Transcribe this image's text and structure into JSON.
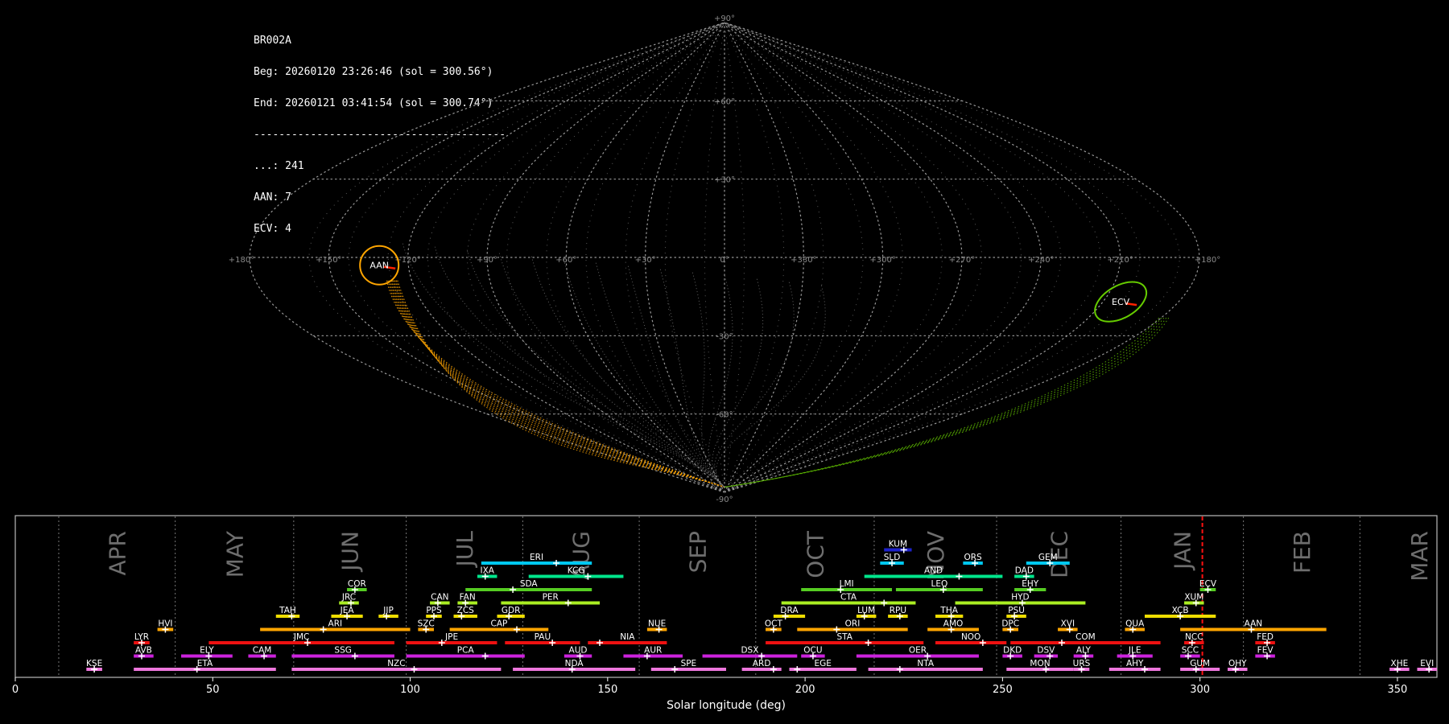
{
  "info": {
    "lines": [
      "BR002A",
      "Beg: 20260120 23:26:46 (sol = 300.56°)",
      "End: 20260121 03:41:54 (sol = 300.74°)",
      "----------------------------------------",
      "...: 241",
      "AAN: 7",
      "ECV: 4"
    ]
  },
  "chart_data": [
    {
      "type": "scatter",
      "projection": "sinusoidal",
      "lon_labels": [
        "+180°",
        "+150°",
        "+120°",
        "+90°",
        "+60°",
        "+30°",
        "0°",
        "+330°",
        "+300°",
        "+270°",
        "+240°",
        "+210°",
        "+180°"
      ],
      "lat_labels": [
        "+90°",
        "+60°",
        "+30°",
        "-30°",
        "-60°",
        "-90°"
      ],
      "showers": [
        {
          "code": "AAN",
          "lon": 150,
          "lat": -7,
          "color": "#ffa500",
          "count": 7
        },
        {
          "code": "ECV",
          "lon": 196,
          "lat": -20,
          "color": "#66cc00",
          "count": 4
        }
      ],
      "sporadic_count": 241,
      "grid": true
    },
    {
      "type": "gantt",
      "xlabel": "Solar longitude (deg)",
      "xlim": [
        0,
        360
      ],
      "xticks": [
        0,
        50,
        100,
        150,
        200,
        250,
        300,
        350
      ],
      "current_sol": 300.6,
      "months": [
        {
          "label": "APR",
          "start": 11
        },
        {
          "label": "MAY",
          "start": 40.5
        },
        {
          "label": "JUN",
          "start": 70.5
        },
        {
          "label": "JUL",
          "start": 99
        },
        {
          "label": "AUG",
          "start": 128.5
        },
        {
          "label": "SEP",
          "start": 158
        },
        {
          "label": "OCT",
          "start": 187.5
        },
        {
          "label": "NOV",
          "start": 217.5
        },
        {
          "label": "DEC",
          "start": 248.5
        },
        {
          "label": "JAN",
          "start": 280
        },
        {
          "label": "FEB",
          "start": 311
        },
        {
          "label": "MAR",
          "start": 340.5
        }
      ],
      "bars": [
        {
          "code": "KUM",
          "s": 220,
          "e": 227,
          "p": 225,
          "row": 9,
          "color": "#1e22cc"
        },
        {
          "code": "ERI",
          "s": 118,
          "e": 146,
          "p": 137,
          "row": 8,
          "color": "#00c8f0"
        },
        {
          "code": "SLD",
          "s": 219,
          "e": 225,
          "p": 222,
          "row": 8,
          "color": "#00c8f0"
        },
        {
          "code": "ORS",
          "s": 240,
          "e": 245,
          "p": 243,
          "row": 8,
          "color": "#00c8f0"
        },
        {
          "code": "GEM",
          "s": 256,
          "e": 267,
          "p": 262,
          "row": 8,
          "color": "#00c8f0"
        },
        {
          "code": "IXA",
          "s": 117,
          "e": 122,
          "p": 119,
          "row": 7,
          "color": "#00e68c"
        },
        {
          "code": "KCG",
          "s": 130,
          "e": 154,
          "p": 145,
          "row": 7,
          "color": "#00e68c"
        },
        {
          "code": "AND",
          "s": 215,
          "e": 250,
          "p": 239,
          "row": 7,
          "color": "#00e68c"
        },
        {
          "code": "DAD",
          "s": 253,
          "e": 258,
          "p": 256,
          "row": 7,
          "color": "#00e68c"
        },
        {
          "code": "COR",
          "s": 84,
          "e": 89,
          "p": 86,
          "row": 6,
          "color": "#55cc22"
        },
        {
          "code": "SDA",
          "s": 114,
          "e": 146,
          "p": 126,
          "row": 6,
          "color": "#55cc22"
        },
        {
          "code": "LMI",
          "s": 199,
          "e": 222,
          "p": 209,
          "row": 6,
          "color": "#55cc22"
        },
        {
          "code": "LEQ",
          "s": 223,
          "e": 245,
          "p": 235,
          "row": 6,
          "color": "#55cc22"
        },
        {
          "code": "EHY",
          "s": 253,
          "e": 261,
          "p": 257,
          "row": 6,
          "color": "#55cc22"
        },
        {
          "code": "ECV",
          "s": 300,
          "e": 304,
          "p": 302,
          "row": 6,
          "color": "#55cc22"
        },
        {
          "code": "JRC",
          "s": 82,
          "e": 87,
          "p": 85,
          "row": 5,
          "color": "#aaee22"
        },
        {
          "code": "CAN",
          "s": 105,
          "e": 110,
          "p": 107,
          "row": 5,
          "color": "#aaee22"
        },
        {
          "code": "FAN",
          "s": 112,
          "e": 117,
          "p": 114,
          "row": 5,
          "color": "#aaee22"
        },
        {
          "code": "PER",
          "s": 123,
          "e": 148,
          "p": 140,
          "row": 5,
          "color": "#aaee22"
        },
        {
          "code": "CTA",
          "s": 194,
          "e": 228,
          "p": 220,
          "row": 5,
          "color": "#aaee22"
        },
        {
          "code": "HYD",
          "s": 238,
          "e": 271,
          "p": 255,
          "row": 5,
          "color": "#aaee22"
        },
        {
          "code": "XUM",
          "s": 296,
          "e": 301,
          "p": 299,
          "row": 5,
          "color": "#aaee22"
        },
        {
          "code": "TAH",
          "s": 66,
          "e": 72,
          "p": 70,
          "row": 4,
          "color": "#eedd00"
        },
        {
          "code": "JEA",
          "s": 80,
          "e": 88,
          "p": 84,
          "row": 4,
          "color": "#eedd00"
        },
        {
          "code": "JIP",
          "s": 92,
          "e": 97,
          "p": 94,
          "row": 4,
          "color": "#eedd00"
        },
        {
          "code": "PPS",
          "s": 104,
          "e": 108,
          "p": 106,
          "row": 4,
          "color": "#eedd00"
        },
        {
          "code": "ZCS",
          "s": 111,
          "e": 117,
          "p": 113,
          "row": 4,
          "color": "#eedd00"
        },
        {
          "code": "GDR",
          "s": 122,
          "e": 129,
          "p": 125,
          "row": 4,
          "color": "#eedd00"
        },
        {
          "code": "DRA",
          "s": 192,
          "e": 200,
          "p": 195,
          "row": 4,
          "color": "#eedd00"
        },
        {
          "code": "LUM",
          "s": 213,
          "e": 218,
          "p": 215,
          "row": 4,
          "color": "#eedd00"
        },
        {
          "code": "RPU",
          "s": 221,
          "e": 226,
          "p": 224,
          "row": 4,
          "color": "#eedd00"
        },
        {
          "code": "THA",
          "s": 233,
          "e": 240,
          "p": 237,
          "row": 4,
          "color": "#eedd00"
        },
        {
          "code": "PSU",
          "s": 251,
          "e": 256,
          "p": 253,
          "row": 4,
          "color": "#eedd00"
        },
        {
          "code": "XCB",
          "s": 286,
          "e": 304,
          "p": 295,
          "row": 4,
          "color": "#eedd00"
        },
        {
          "code": "HVI",
          "s": 36,
          "e": 40,
          "p": 38,
          "row": 3,
          "color": "#ffa500"
        },
        {
          "code": "ARI",
          "s": 62,
          "e": 100,
          "p": 78,
          "row": 3,
          "color": "#ffa500"
        },
        {
          "code": "SZC",
          "s": 102,
          "e": 106,
          "p": 104,
          "row": 3,
          "color": "#ffa500"
        },
        {
          "code": "CAP",
          "s": 110,
          "e": 135,
          "p": 127,
          "row": 3,
          "color": "#ffa500"
        },
        {
          "code": "NUE",
          "s": 160,
          "e": 165,
          "p": 163,
          "row": 3,
          "color": "#ffa500"
        },
        {
          "code": "OCT",
          "s": 190,
          "e": 194,
          "p": 192,
          "row": 3,
          "color": "#ffa500"
        },
        {
          "code": "ORI",
          "s": 198,
          "e": 226,
          "p": 208,
          "row": 3,
          "color": "#ffa500"
        },
        {
          "code": "AMO",
          "s": 231,
          "e": 244,
          "p": 237,
          "row": 3,
          "color": "#ffa500"
        },
        {
          "code": "DPC",
          "s": 250,
          "e": 254,
          "p": 252,
          "row": 3,
          "color": "#ffa500"
        },
        {
          "code": "XVI",
          "s": 264,
          "e": 269,
          "p": 267,
          "row": 3,
          "color": "#ffa500"
        },
        {
          "code": "QUA",
          "s": 281,
          "e": 286,
          "p": 283,
          "row": 3,
          "color": "#ffa500"
        },
        {
          "code": "AAN",
          "s": 295,
          "e": 332,
          "p": 313,
          "row": 3,
          "color": "#ffa500"
        },
        {
          "code": "LYR",
          "s": 30,
          "e": 34,
          "p": 32,
          "row": 2,
          "color": "#ee1111"
        },
        {
          "code": "JMC",
          "s": 49,
          "e": 96,
          "p": 74,
          "row": 2,
          "color": "#ee1111"
        },
        {
          "code": "JPE",
          "s": 99,
          "e": 122,
          "p": 108,
          "row": 2,
          "color": "#ee1111"
        },
        {
          "code": "PAU",
          "s": 124,
          "e": 143,
          "p": 136,
          "row": 2,
          "color": "#ee1111"
        },
        {
          "code": "NIA",
          "s": 145,
          "e": 165,
          "p": 148,
          "row": 2,
          "color": "#ee1111"
        },
        {
          "code": "STA",
          "s": 190,
          "e": 230,
          "p": 216,
          "row": 2,
          "color": "#ee1111"
        },
        {
          "code": "NOO",
          "s": 233,
          "e": 251,
          "p": 245,
          "row": 2,
          "color": "#ee1111"
        },
        {
          "code": "COM",
          "s": 252,
          "e": 290,
          "p": 265,
          "row": 2,
          "color": "#ee1111"
        },
        {
          "code": "NCC",
          "s": 296,
          "e": 301,
          "p": 298,
          "row": 2,
          "color": "#ee1111"
        },
        {
          "code": "FED",
          "s": 314,
          "e": 319,
          "p": 317,
          "row": 2,
          "color": "#ee1111"
        },
        {
          "code": "AVB",
          "s": 30,
          "e": 35,
          "p": 32,
          "row": 1,
          "color": "#cc22dd"
        },
        {
          "code": "ELY",
          "s": 42,
          "e": 55,
          "p": 49,
          "row": 1,
          "color": "#cc22dd"
        },
        {
          "code": "CAM",
          "s": 59,
          "e": 66,
          "p": 63,
          "row": 1,
          "color": "#cc22dd"
        },
        {
          "code": "SSG",
          "s": 70,
          "e": 96,
          "p": 86,
          "row": 1,
          "color": "#cc22dd"
        },
        {
          "code": "PCA",
          "s": 99,
          "e": 129,
          "p": 119,
          "row": 1,
          "color": "#cc22dd"
        },
        {
          "code": "AUD",
          "s": 139,
          "e": 146,
          "p": 143,
          "row": 1,
          "color": "#cc22dd"
        },
        {
          "code": "AUR",
          "s": 154,
          "e": 169,
          "p": 160,
          "row": 1,
          "color": "#cc22dd"
        },
        {
          "code": "DSX",
          "s": 174,
          "e": 198,
          "p": 189,
          "row": 1,
          "color": "#cc22dd"
        },
        {
          "code": "OCU",
          "s": 199,
          "e": 205,
          "p": 202,
          "row": 1,
          "color": "#cc22dd"
        },
        {
          "code": "OER",
          "s": 213,
          "e": 244,
          "p": 231,
          "row": 1,
          "color": "#cc22dd"
        },
        {
          "code": "DKD",
          "s": 250,
          "e": 255,
          "p": 252,
          "row": 1,
          "color": "#cc22dd"
        },
        {
          "code": "DSV",
          "s": 258,
          "e": 264,
          "p": 262,
          "row": 1,
          "color": "#cc22dd"
        },
        {
          "code": "ALY",
          "s": 268,
          "e": 273,
          "p": 271,
          "row": 1,
          "color": "#cc22dd"
        },
        {
          "code": "JLE",
          "s": 279,
          "e": 288,
          "p": 283,
          "row": 1,
          "color": "#cc22dd"
        },
        {
          "code": "SCC",
          "s": 295,
          "e": 300,
          "p": 297,
          "row": 1,
          "color": "#cc22dd"
        },
        {
          "code": "FEV",
          "s": 314,
          "e": 319,
          "p": 317,
          "row": 1,
          "color": "#cc22dd"
        },
        {
          "code": "KSE",
          "s": 18,
          "e": 22,
          "p": 20,
          "row": 0,
          "color": "#ee77dd"
        },
        {
          "code": "ETA",
          "s": 30,
          "e": 66,
          "p": 46,
          "row": 0,
          "color": "#ee77dd"
        },
        {
          "code": "NZC",
          "s": 70,
          "e": 123,
          "p": 101,
          "row": 0,
          "color": "#ee77dd"
        },
        {
          "code": "NDA",
          "s": 126,
          "e": 157,
          "p": 141,
          "row": 0,
          "color": "#ee77dd"
        },
        {
          "code": "SPE",
          "s": 161,
          "e": 180,
          "p": 167,
          "row": 0,
          "color": "#ee77dd"
        },
        {
          "code": "ARD",
          "s": 184,
          "e": 194,
          "p": 192,
          "row": 0,
          "color": "#ee77dd"
        },
        {
          "code": "EGE",
          "s": 196,
          "e": 213,
          "p": 198,
          "row": 0,
          "color": "#ee77dd"
        },
        {
          "code": "NTA",
          "s": 216,
          "e": 245,
          "p": 224,
          "row": 0,
          "color": "#ee77dd"
        },
        {
          "code": "MON",
          "s": 251,
          "e": 268,
          "p": 261,
          "row": 0,
          "color": "#ee77dd"
        },
        {
          "code": "URS",
          "s": 268,
          "e": 272,
          "p": 270,
          "row": 0,
          "color": "#ee77dd"
        },
        {
          "code": "AHY",
          "s": 277,
          "e": 290,
          "p": 286,
          "row": 0,
          "color": "#ee77dd"
        },
        {
          "code": "GUM",
          "s": 295,
          "e": 305,
          "p": 299,
          "row": 0,
          "color": "#ee77dd"
        },
        {
          "code": "OHY",
          "s": 307,
          "e": 312,
          "p": 309,
          "row": 0,
          "color": "#ee77dd"
        },
        {
          "code": "XHE",
          "s": 348,
          "e": 353,
          "p": 350,
          "row": 0,
          "color": "#ee77dd"
        },
        {
          "code": "EVI",
          "s": 355,
          "e": 360,
          "p": 358,
          "row": 0,
          "color": "#ee77dd"
        }
      ]
    }
  ]
}
